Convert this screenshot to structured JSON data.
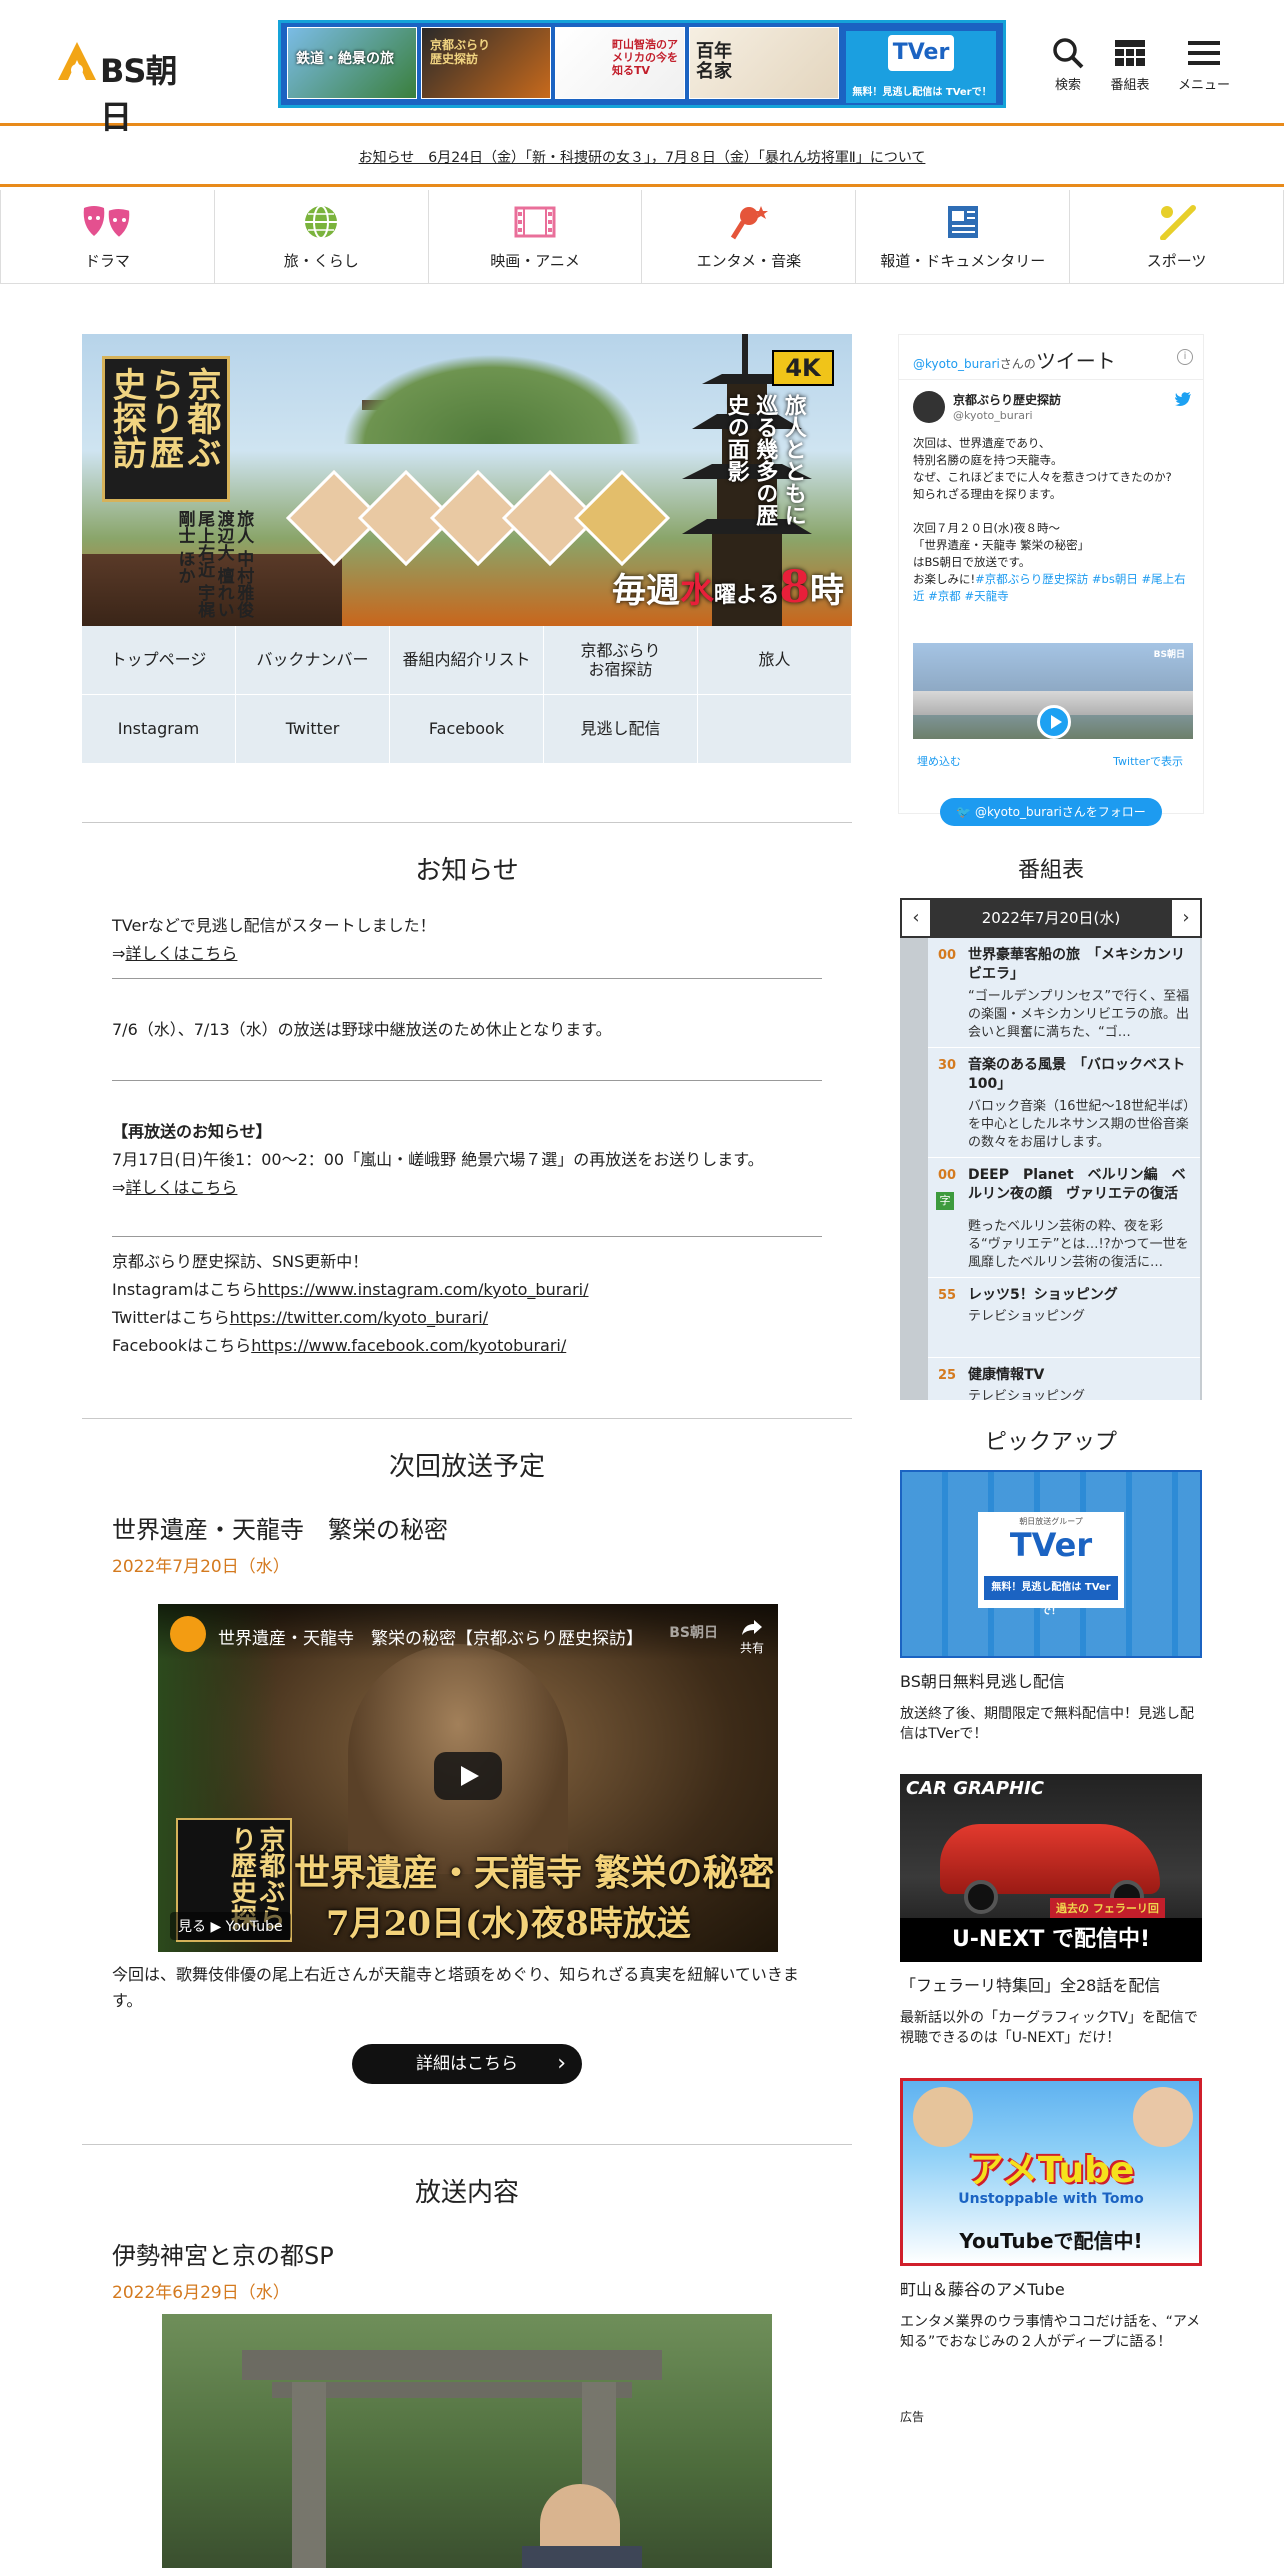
{
  "header": {
    "logo_text": "BS朝日",
    "buttons": [
      {
        "label": "検索",
        "icon": "search-icon"
      },
      {
        "label": "番組表",
        "icon": "schedule-grid-icon"
      },
      {
        "label": "メニュー",
        "icon": "hamburger-menu-icon"
      }
    ],
    "banner": {
      "tver_logo": "TVer",
      "tver_text": "無料！見逃し配信は TVerで！",
      "thumb1": "鉄道・絶景の旅",
      "thumb2": "京都ぶらり歴史探訪",
      "thumb3": "町山智浩のアメリカの今を知るTV",
      "thumb4": "百年名家"
    }
  },
  "notice": "お知らせ　6月24日（金）「新・科捜研の女３」，7月８日（金）「暴れん坊将軍Ⅱ」について",
  "categories": [
    {
      "label": "ドラマ",
      "icon": "drama-masks-icon",
      "color": "#e4508f"
    },
    {
      "label": "旅・くらし",
      "icon": "globe-icon",
      "color": "#7ab33c"
    },
    {
      "label": "映画・アニメ",
      "icon": "film-icon",
      "color": "#e96f9a"
    },
    {
      "label": "エンタメ・音楽",
      "icon": "microphone-star-icon",
      "color": "#e5553a"
    },
    {
      "label": "報道・ドキュメンタリー",
      "icon": "newspaper-icon",
      "color": "#2e6db5"
    },
    {
      "label": "スポーツ",
      "icon": "bat-ball-icon",
      "color": "#e7cf2a"
    }
  ],
  "hero": {
    "title": "京都ぶらり歴史探訪",
    "badge": "4K",
    "subtitle": "旅人とともに巡る幾多の歴史の面影",
    "cast": "旅人 中村雅俊 渡辺大 檀れい 尾上右近 宇梶剛士 ほか",
    "schedule_prefix": "毎週",
    "schedule_day": "水",
    "schedule_mid": "曜よる",
    "schedule_time": "8",
    "schedule_suffix": "時"
  },
  "program_menu": [
    "トップページ",
    "バックナンバー",
    "番組内紹介リスト",
    "京都ぶらり\nお宿探訪",
    "旅人",
    "Instagram",
    "Twitter",
    "Facebook",
    "見逃し配信",
    ""
  ],
  "news": {
    "title": "お知らせ",
    "item1_text": "TVerなどで見逃し配信がスタートしました！",
    "item1_arrow": "⇒",
    "item1_link": "詳しくはこちら",
    "item2_text": "7/6（水）、7/13（水）の放送は野球中継放送のため休止となります。",
    "item3_head": "【再放送のお知らせ】",
    "item3_text": "7月17日(日)午後1：00～2：00「嵐山・嵯峨野 絶景穴場７選」の再放送をお送りします。",
    "item3_arrow": "⇒",
    "item3_link": "詳しくはこちら",
    "item4_text": "京都ぶらり歴史探訪、SNS更新中！",
    "insta_prefix": "Instagramはこちら",
    "insta_link": "https://www.instagram.com/kyoto_burari/",
    "twitter_prefix": "Twitterはこちら",
    "twitter_link": "https://twitter.com/kyoto_burari/",
    "facebook_prefix": "Facebookはこちら",
    "facebook_link": "https://www.facebook.com/kyotoburari/"
  },
  "next": {
    "section_title": "次回放送予定",
    "title": "世界遺産・天龍寺　繁栄の秘密",
    "date": "2022年7月20日（水）",
    "video_title": "世界遺産・天龍寺　繁栄の秘密【京都ぶらり歴史探訪】",
    "video_share": "共有",
    "video_cap1": "世界遺産・天龍寺 繁栄の秘密",
    "video_cap2": "7月20日(水)夜8時放送",
    "video_badge": "京都ぶらり歴史探",
    "video_watch": "見る ▶ YouTube",
    "video_channel": "BS朝日",
    "description": "今回は、歌舞伎俳優の尾上右近さんが天龍寺と塔頭をめぐり、知られざる真実を紐解いていきます。",
    "button": "詳細はこちら"
  },
  "broadcast": {
    "section_title": "放送内容",
    "title": "伊勢神宮と京の都SP",
    "date": "2022年6月29日（水）"
  },
  "twitter": {
    "handle_prefix": "@kyoto_burari",
    "handle_suffix": "さんの",
    "heading": "ツイート",
    "info": "i",
    "name": "京都ぶらり歴史探訪",
    "handle": "@kyoto_burari",
    "line1": "次回は、世界遺産であり、",
    "line2": "特別名勝の庭を持つ天龍寺。",
    "line3": "なぜ、これほどまでに人々を惹きつけてきたのか?",
    "line4": "知られざる理由を探ります。",
    "line5": "次回７月２０日(水)夜８時～",
    "line6": "「世界遺産・天龍寺 繁栄の秘密」",
    "line7": "はBS朝日で放送です。",
    "line8_prefix": "お楽しみに!",
    "line8_tags": "#京都ぶらり歴史探訪 #bs朝日 #尾上右近 #京都 #天龍寺",
    "video_logo": "BS朝日",
    "embed": "埋め込む",
    "view": "Twitterで表示",
    "follow": "@kyoto_burariさんをフォロー"
  },
  "schedule": {
    "title": "番組表",
    "date": "2022年7月20日(水)",
    "prev": "‹",
    "next": "›",
    "items": [
      {
        "minute": "00",
        "name": "世界豪華客船の旅　「メキシカンリビエラ」",
        "desc": "“ゴールデンプリンセス”で行く、至福の楽園・メキシカンリビエラの旅。出会いと興奮に満ちた、“ゴ…"
      },
      {
        "minute": "30",
        "name": "音楽のある風景　「バロックベスト100」",
        "desc": "バロック音楽（16世紀～18世紀半ば）を中心としたルネサンス期の世俗音楽の数々をお届けします。"
      },
      {
        "minute": "00",
        "badge": "字",
        "name": "DEEP　Planet　ベルリン編　ベルリン夜の顔　ヴァリエテの復活",
        "desc": "甦ったベルリン芸術の粋、夜を彩る“ヴァリエテ”とは…!?かつて一世を風靡したベルリン芸術の復活に…"
      },
      {
        "minute": "55",
        "name": "レッツ5！ショッピング",
        "desc": "テレビショッピング"
      },
      {
        "minute": "25",
        "name": "健康情報TV",
        "desc": "テレビショッピング"
      }
    ]
  },
  "pickup": {
    "title": "ピックアップ",
    "items": [
      {
        "caption": "BS朝日無料見逃し配信",
        "desc": "放送終了後、期間限定で無料配信中！見逃し配信はTVerで！",
        "img_logo": "TVer",
        "img_text": "無料！見逃し配信は TVerで！",
        "img_small": "朝日放送グループ"
      },
      {
        "caption": "「フェラーリ特集回」全28話を配信",
        "desc": "最新話以外の「カーグラフィックTV」を配信で視聴できるのは「U-NEXT」だけ！",
        "img_logo": "CAR GRAPHIC",
        "img_text": "U-NEXT で配信中!",
        "img_small": "過去の フェラーリ回"
      },
      {
        "caption": "町山＆藤谷のアメTube",
        "desc": "エンタメ業界のウラ事情やココだけ話を、“アメ知る”でおなじみの２人がディープに語る！",
        "img_logo": "アメTube",
        "img_text": "YouTubeで配信中!",
        "img_small": "Unstoppable with Tomo"
      }
    ]
  },
  "ad_label": "広告"
}
